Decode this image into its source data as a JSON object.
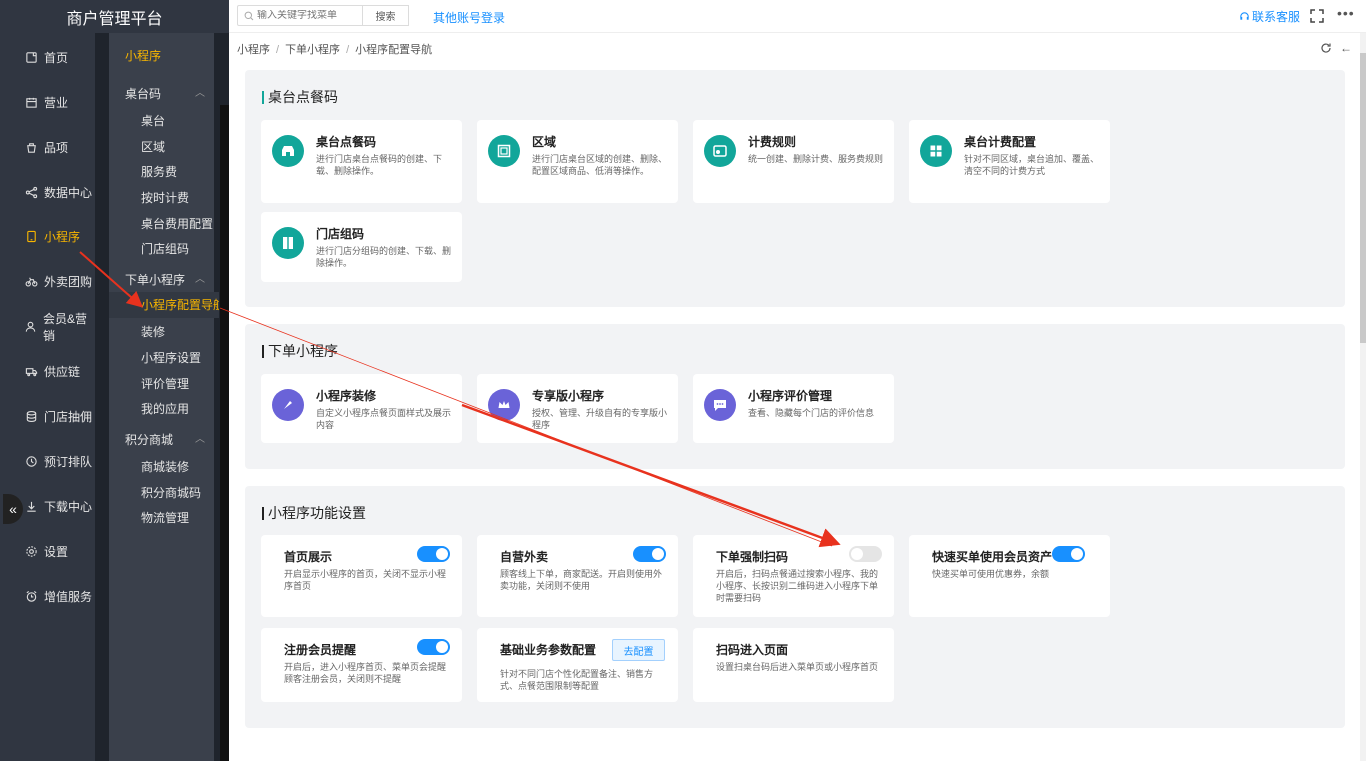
{
  "app": {
    "brand": "商户管理平台"
  },
  "leftnav": [
    {
      "label": "首页",
      "icon": "home-icon"
    },
    {
      "label": "营业",
      "icon": "calendar-icon"
    },
    {
      "label": "品项",
      "icon": "bag-icon"
    },
    {
      "label": "数据中心",
      "icon": "share-icon"
    },
    {
      "label": "小程序",
      "icon": "phone-icon",
      "active": true
    },
    {
      "label": "外卖团购",
      "icon": "bike-icon"
    },
    {
      "label": "会员&营销",
      "icon": "user-icon"
    },
    {
      "label": "供应链",
      "icon": "truck-icon"
    },
    {
      "label": "门店抽佣",
      "icon": "database-icon"
    },
    {
      "label": "预订排队",
      "icon": "clock-icon"
    },
    {
      "label": "下载中心",
      "icon": "download-icon"
    },
    {
      "label": "设置",
      "icon": "gear-icon"
    },
    {
      "label": "增值服务",
      "icon": "alarm-icon"
    }
  ],
  "subnav": {
    "header": "小程序",
    "groups": [
      {
        "label": "桌台码",
        "items": [
          "桌台",
          "区域",
          "服务费",
          "按时计费",
          "桌台费用配置",
          "门店组码"
        ]
      },
      {
        "label": "下单小程序",
        "items": [
          "小程序配置导航",
          "装修",
          "小程序设置",
          "评价管理",
          "我的应用"
        ]
      },
      {
        "label": "积分商城",
        "items": [
          "商城装修",
          "积分商城码",
          "物流管理"
        ]
      }
    ],
    "active_item": "小程序配置导航"
  },
  "topbar": {
    "search_placeholder": "输入关键字找菜单",
    "search_button": "搜索",
    "other_login": "其他账号登录",
    "contact": "联系客服",
    "more": "•••"
  },
  "breadcrumb": [
    "小程序",
    "下单小程序",
    "小程序配置导航"
  ],
  "sections": {
    "table_code": {
      "title": "桌台点餐码",
      "cards": [
        {
          "title": "桌台点餐码",
          "desc": "进行门店桌台点餐码的创建、下载、删除操作。",
          "icon": "shop-icon"
        },
        {
          "title": "区域",
          "desc": "进行门店桌台区域的创建、删除、配置区域商品、低消等操作。",
          "icon": "area-icon"
        },
        {
          "title": "计费规则",
          "desc": "统一创建、删除计费、服务费规则",
          "icon": "billing-icon"
        },
        {
          "title": "桌台计费配置",
          "desc": "针对不同区域，桌台追加、覆盖、清空不同的计费方式",
          "icon": "grid-icon"
        },
        {
          "title": "门店组码",
          "desc": "进行门店分组码的创建、下载、删除操作。",
          "icon": "door-icon"
        }
      ]
    },
    "mini_program": {
      "title": "下单小程序",
      "cards": [
        {
          "title": "小程序装修",
          "desc": "自定义小程序点餐页面样式及展示内容",
          "icon": "brush-icon"
        },
        {
          "title": "专享版小程序",
          "desc": "授权、管理、升级自有的专享版小程序",
          "icon": "crown-icon"
        },
        {
          "title": "小程序评价管理",
          "desc": "查看、隐藏每个门店的评价信息",
          "icon": "comment-icon"
        }
      ]
    },
    "functions": {
      "title": "小程序功能设置",
      "cards": [
        {
          "title": "首页展示",
          "desc": "开启显示小程序的首页，关闭不显示小程序首页",
          "toggle": true
        },
        {
          "title": "自营外卖",
          "desc": "顾客线上下单，商家配送。开启则使用外卖功能，关闭则不使用",
          "toggle": true
        },
        {
          "title": "下单强制扫码",
          "desc": "开启后，扫码点餐通过搜索小程序、我的小程序、长按识别二维码进入小程序下单时需要扫码",
          "toggle": false
        },
        {
          "title": "快速买单使用会员资产",
          "desc": "快速买单可使用优惠券，余额",
          "toggle": true
        },
        {
          "title": "注册会员提醒",
          "desc": "开启后，进入小程序首页、菜单页会提醒顾客注册会员，关闭则不提醒",
          "toggle": true
        },
        {
          "title": "基础业务参数配置",
          "desc": "针对不同门店个性化配置备注、销售方式、点餐范围限制等配置",
          "button": "去配置"
        },
        {
          "title": "扫码进入页面",
          "desc": "设置扫桌台码后进入菜单页或小程序首页"
        }
      ]
    }
  },
  "colors": {
    "accent": "#1890ff",
    "active_nav": "#f7b500",
    "teal": "#12a69a",
    "purple": "#6a63d8",
    "arrow": "#e8321e"
  }
}
